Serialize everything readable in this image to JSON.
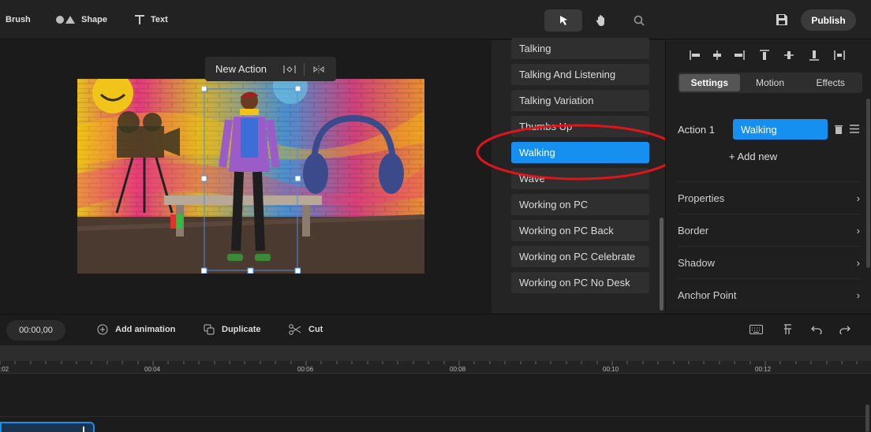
{
  "toolbar": {
    "brush_label": "Brush",
    "shape_label": "Shape",
    "text_label": "Text",
    "publish_label": "Publish",
    "mid_tools": [
      "pointer-icon",
      "hand-icon",
      "search-icon"
    ]
  },
  "canvas": {
    "action_label": "New Action"
  },
  "actions_list": {
    "items": [
      "Talking",
      "Talking And Listening",
      "Talking Variation",
      "Thumbs Up",
      "Walking",
      "Wave",
      "Working on PC",
      "Working on PC Back",
      "Working on PC Celebrate",
      "Working on PC No Desk"
    ],
    "selected": "Walking"
  },
  "right_panel": {
    "tabs": [
      "Settings",
      "Motion",
      "Effects"
    ],
    "active_tab": "Settings",
    "action_label": "Action 1",
    "action_value": "Walking",
    "add_new": "+ Add new",
    "sections": [
      "Properties",
      "Border",
      "Shadow",
      "Anchor Point"
    ]
  },
  "timeline": {
    "timecode": "00:00,00",
    "add_animation": "Add animation",
    "duplicate": "Duplicate",
    "cut": "Cut",
    "ticks": [
      ":02",
      "00:04",
      "00:06",
      "00:08",
      "00:10",
      "00:12"
    ]
  },
  "colors": {
    "accent": "#1690f0",
    "annotation": "#e0141b"
  }
}
